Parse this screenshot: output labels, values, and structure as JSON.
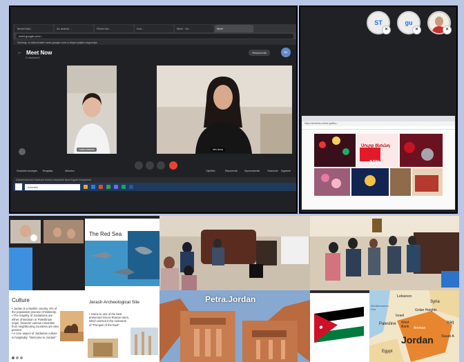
{
  "meet": {
    "tabs": [
      "Tanítói fióki...",
      "Az arabok ...",
      "Rövid tört...",
      "Kon...",
      "Meet - Sz...",
      "Meet"
    ],
    "address": "meet.google.com/...",
    "info_bar": "Szöveg: a videóchatet meet.google.com a képernyőjét megosztja",
    "title": "Meet Now",
    "subtitle": "2 résztvevő",
    "layout_pill": "Résztvevők",
    "user_initial": "Bri",
    "participant1": "Csaba Mariam",
    "participant2": "Irén Anna",
    "controls": [
      "Hívásbeli csevegés",
      "Reagálás",
      "Mikrofon",
      "Kamera",
      "Képernyőmegosztás",
      "Hívás befejezése",
      "Kijelölés",
      "Résztvevők",
      "Gyorsreakciók",
      "Eszközök",
      "Egyebek"
    ],
    "bookmarks": "Dokumentumok  Facebook  Kultúra  Irányelvek  Sport  Egyéb könyvjelzők",
    "search_placeholder": "Keresés"
  },
  "participants": {
    "chip1": "ST",
    "chip2": "gu"
  },
  "shared": {
    "address": "https://armenia-culture-gallery...",
    "banner_text": "Սուրբ ծնունդ",
    "promo_text": "15%"
  },
  "slides": {
    "red_sea_title": "The Red Sea",
    "petra_title": "Petra.Jordan",
    "culture_title": "Culture",
    "culture_bullets": [
      "Jordan is a Muslim country. 9% of the population practice Christianity.",
      "The majority of Jordanians are either of Bedouin or Palestinian origin, however various minorities from neighbouring countries are also present.",
      "A core aspect of Jordanian culture is hospitality. \"Welcome to Jordan!\""
    ],
    "jerash_title": "Jerash Archeological Site",
    "jerash_bullets": [
      "Home to one of the best preserved Greco-Roman cities, which earned it the nickname of \"Pompeii of the East\""
    ]
  },
  "map": {
    "labels": [
      "Lebanon",
      "Syria",
      "Mediterranean Sea",
      "Israel",
      "Golan Heights",
      "West Bank",
      "Amman",
      "Palestine",
      "Iraq",
      "Saudi A",
      "Egypt",
      "Jordan"
    ]
  },
  "colors": {
    "meet_bg": "#202124",
    "accent": "#1a73e8",
    "end_call": "#ea4335",
    "page_bg": "#b9c7e4"
  }
}
